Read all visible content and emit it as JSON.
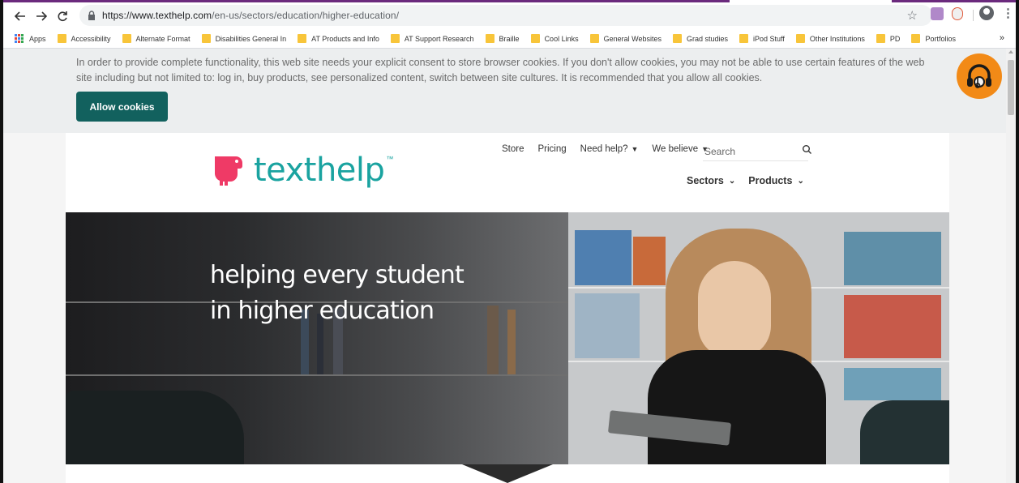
{
  "browser": {
    "url_base": "https://www.texthelp.com",
    "url_path": "/en-us/sectors/education/higher-education/",
    "bookmarks": [
      "Apps",
      "Accessibility",
      "Alternate Format",
      "Disabilities General In",
      "AT Products and Info",
      "AT Support Research",
      "Braille",
      "Cool Links",
      "General Websites",
      "Grad studies",
      "iPod Stuff",
      "Other Institutions",
      "PD",
      "Portfolios"
    ],
    "more_bookmarks": "»"
  },
  "cookie_banner": {
    "message": "In order to provide complete functionality, this web site needs your explicit consent to store browser cookies. If you don't allow cookies, you may not be able to use certain features of the web site including but not limited to: log in, buy products, see personalized content, switch between site cultures. It is recommended that you allow all cookies.",
    "button_label": "Allow cookies"
  },
  "site": {
    "logo_text": "texthelp",
    "logo_tm": "™",
    "top_nav": [
      {
        "label": "Store",
        "has_caret": false
      },
      {
        "label": "Pricing",
        "has_caret": false
      },
      {
        "label": "Need help?",
        "has_caret": true
      },
      {
        "label": "We believe",
        "has_caret": true
      }
    ],
    "search_placeholder": "Search",
    "main_nav": [
      {
        "label": "Sectors"
      },
      {
        "label": "Products"
      }
    ],
    "hero_title_line1": "helping every student",
    "hero_title_line2": "in higher education"
  },
  "colors": {
    "brand_teal": "#1aa3a0",
    "brand_pink": "#ef3a66",
    "cookie_button": "#12615e",
    "browsealoud_orange": "#f28a17"
  }
}
